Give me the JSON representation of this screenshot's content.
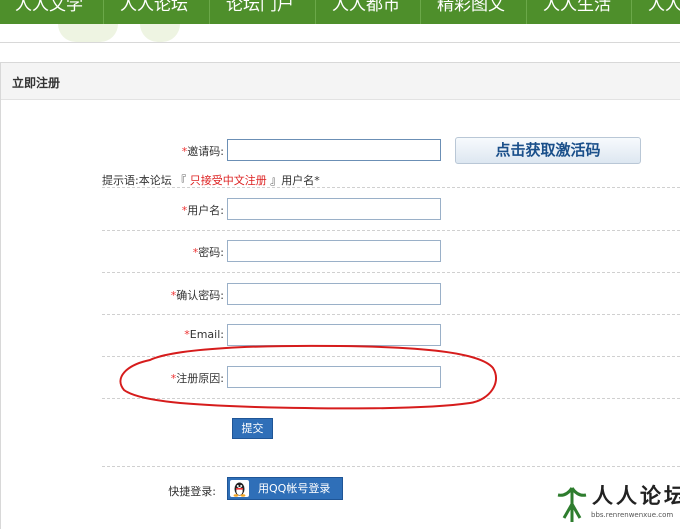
{
  "nav": {
    "items": [
      "人人文学",
      "人人论坛",
      "论坛门户",
      "人人都市",
      "精彩图文",
      "人人生活",
      "人人"
    ]
  },
  "panel": {
    "title": "立即注册"
  },
  "form": {
    "required_mark": "*",
    "invite_label": "邀请码:",
    "get_code_label": "点击获取激活码",
    "hint_prefix": "提示语:本论坛 『",
    "hint_highlight": " 只接受中文注册 ",
    "hint_suffix": "』用户名*",
    "username_label": "用户名:",
    "password_label": "密码:",
    "confirm_password_label": "确认密码:",
    "email_label": "Email:",
    "reason_label": "注册原因:",
    "submit_label": "提交"
  },
  "quick_login": {
    "label": "快捷登录:",
    "qq_label": "用QQ帐号登录"
  },
  "watermark": {
    "text": "人人论坛",
    "url": "bbs.renrenwenxue.com"
  },
  "colors": {
    "nav_green": "#4e8f2b",
    "button_blue": "#2f6fb8",
    "required_red": "#e33",
    "annotation_red": "#d61c1c"
  }
}
